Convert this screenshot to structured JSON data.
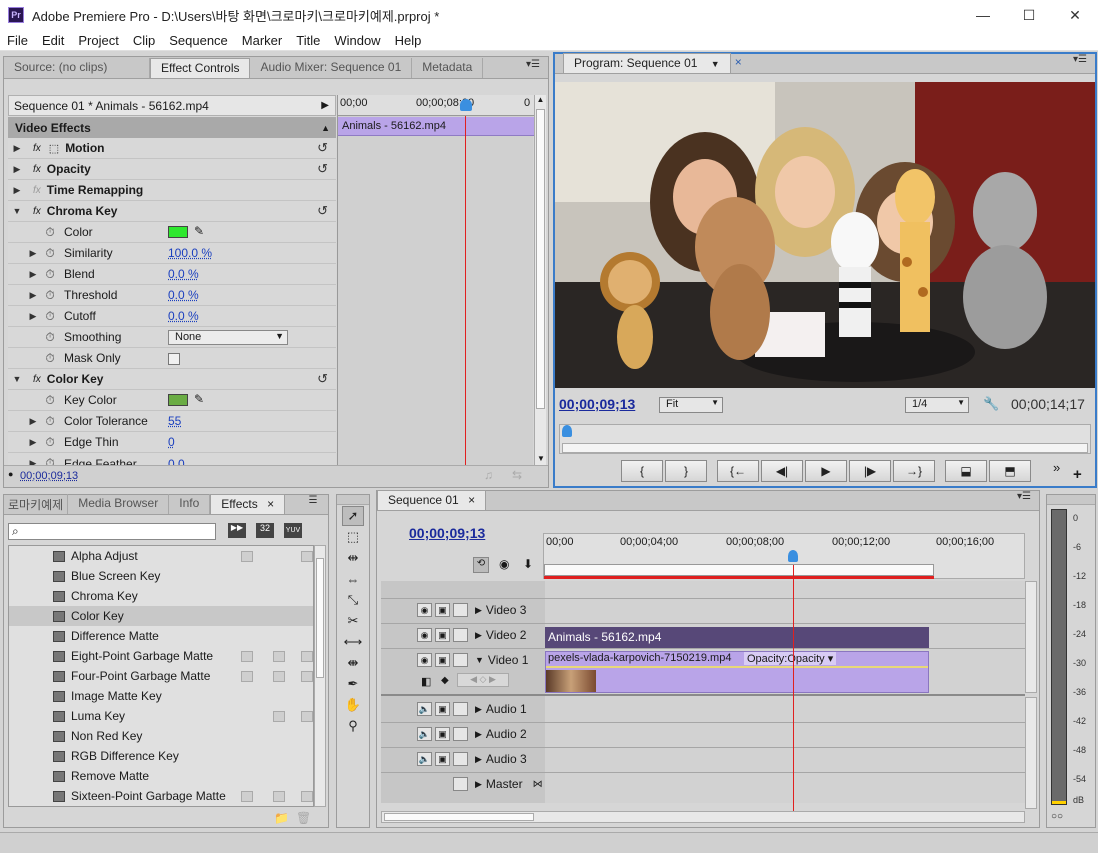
{
  "window": {
    "app_icon": "Pr",
    "title": "Adobe Premiere Pro - D:\\Users\\바탕 화면\\크로마키\\크로마키예제.prproj *",
    "minimize": "—",
    "maximize": "☐",
    "close": "✕"
  },
  "menu": [
    "File",
    "Edit",
    "Project",
    "Clip",
    "Sequence",
    "Marker",
    "Title",
    "Window",
    "Help"
  ],
  "source_panel": {
    "tabs": [
      "Source: (no clips)",
      "Effect Controls",
      "Audio Mixer: Sequence 01",
      "Metadata"
    ],
    "clip_header": "Sequence 01 * Animals - 56162.mp4",
    "ruler": [
      "00;00",
      "00;00;08;00",
      "0"
    ],
    "clip_bar": "Animals - 56162.mp4",
    "section": "Video Effects",
    "effects": [
      {
        "name": "Motion",
        "expanded": false
      },
      {
        "name": "Opacity",
        "expanded": false
      },
      {
        "name": "Time Remapping",
        "expanded": false
      },
      {
        "name": "Chroma Key",
        "expanded": true
      }
    ],
    "chroma_params": [
      {
        "label": "Color",
        "type": "swatch",
        "value": "#2ee82e"
      },
      {
        "label": "Similarity",
        "value": "100.0 %"
      },
      {
        "label": "Blend",
        "value": "0.0 %"
      },
      {
        "label": "Threshold",
        "value": "0.0 %"
      },
      {
        "label": "Cutoff",
        "value": "0.0 %"
      },
      {
        "label": "Smoothing",
        "type": "select",
        "value": "None"
      },
      {
        "label": "Mask Only",
        "type": "checkbox",
        "value": "unchecked"
      }
    ],
    "color_key": {
      "name": "Color Key",
      "params": [
        {
          "label": "Key Color",
          "type": "swatch",
          "value": "#6aac44"
        },
        {
          "label": "Color Tolerance",
          "value": "55"
        },
        {
          "label": "Edge Thin",
          "value": "0"
        },
        {
          "label": "Edge Feather",
          "value": "0.0"
        }
      ]
    },
    "timecode": "00;00;09;13"
  },
  "program": {
    "tab": "Program: Sequence 01",
    "timecode": "00;00;09;13",
    "zoom": "Fit",
    "resolution": "1/4",
    "duration": "00;00;14;17",
    "transport": [
      "{",
      "}",
      "{←",
      "◀|",
      "▶",
      "|▶",
      "→}",
      "⬓",
      "⬒"
    ]
  },
  "effects_panel": {
    "tabs": [
      "로마키예제",
      "Media Browser",
      "Info",
      "Effects"
    ],
    "search_placeholder": "",
    "badges": [
      "32",
      "YUV"
    ],
    "items": [
      "Alpha Adjust",
      "Blue Screen Key",
      "Chroma Key",
      "Color Key",
      "Difference Matte",
      "Eight-Point Garbage Matte",
      "Four-Point Garbage Matte",
      "Image Matte Key",
      "Luma Key",
      "Non Red Key",
      "RGB Difference Key",
      "Remove Matte",
      "Sixteen-Point Garbage Matte"
    ],
    "selected_index": 3
  },
  "timeline": {
    "tab": "Sequence 01",
    "timecode": "00;00;09;13",
    "ruler": [
      "00;00",
      "00;00;04;00",
      "00;00;08;00",
      "00;00;12;00",
      "00;00;16;00"
    ],
    "tracks": [
      "Video 3",
      "Video 2",
      "Video 1",
      "Audio 1",
      "Audio 2",
      "Audio 3",
      "Master"
    ],
    "clips": {
      "video2": "Animals - 56162.mp4",
      "video1": "pexels-vlada-karpovich-7150219.mp4",
      "video1_fx": "Opacity:Opacity"
    }
  },
  "meter": {
    "scale": [
      "0",
      "-6",
      "-12",
      "-18",
      "-24",
      "-30",
      "-36",
      "-42",
      "-48",
      "-54",
      "dB"
    ]
  },
  "colors": {
    "playhead": "#e02020",
    "clip_purple": "#b9a4e8",
    "clip_dark": "#574878",
    "timecode_blue": "#1a2a9c"
  }
}
